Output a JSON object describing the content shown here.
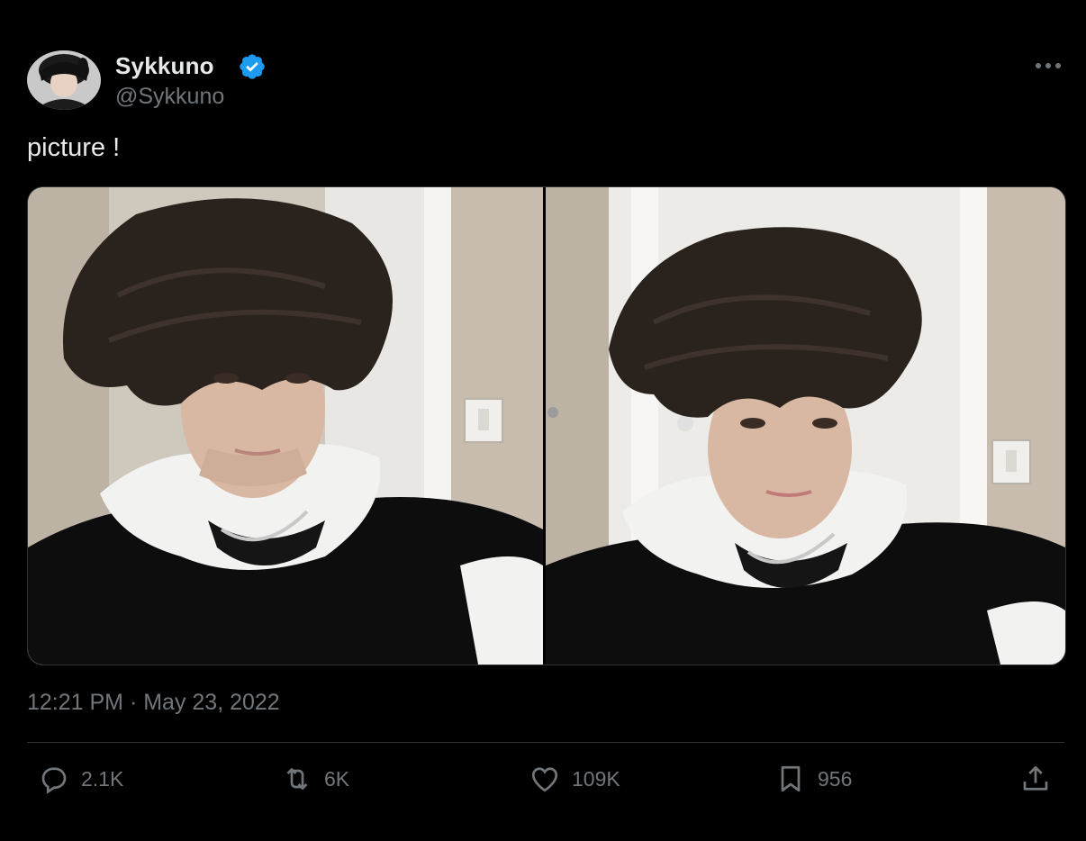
{
  "author": {
    "display_name": "Sykkuno",
    "handle": "@Sykkuno",
    "verified": true
  },
  "tweet": {
    "text": "picture !",
    "timestamp": "12:21 PM · May 23, 2022"
  },
  "media": [
    {
      "description": "selfie-left"
    },
    {
      "description": "selfie-right"
    }
  ],
  "actions": {
    "replies": "2.1K",
    "retweets": "6K",
    "likes": "109K",
    "bookmarks": "956"
  },
  "icons": {
    "verified": "verified-badge-icon",
    "more": "more-options-icon",
    "reply": "reply-icon",
    "retweet": "retweet-icon",
    "like": "heart-icon",
    "bookmark": "bookmark-icon",
    "share": "share-icon"
  },
  "colors": {
    "background": "#000000",
    "text_primary": "#e7e9ea",
    "text_secondary": "#71767b",
    "verified_blue": "#1d9bf0",
    "divider": "#2f3336"
  }
}
